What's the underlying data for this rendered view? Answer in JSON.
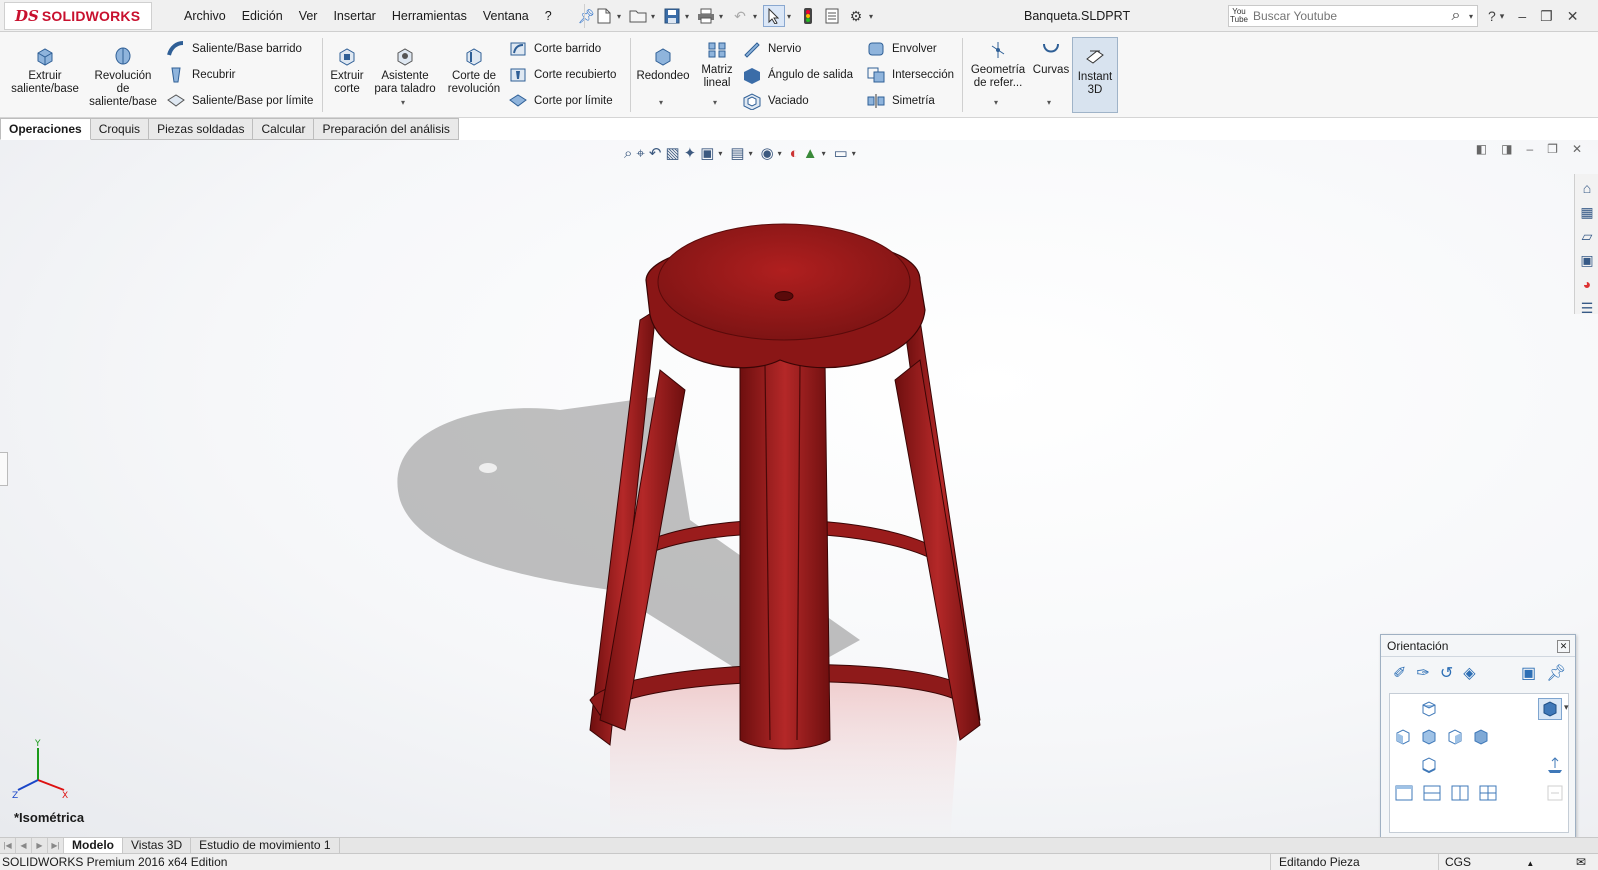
{
  "app": {
    "logo_prefix": "DS",
    "logo_text": "SOLIDWORKS"
  },
  "menu": [
    "Archivo",
    "Edición",
    "Ver",
    "Insertar",
    "Herramientas",
    "Ventana",
    "?"
  ],
  "document_title": "Banqueta.SLDPRT",
  "search": {
    "placeholder": "Buscar Youtube",
    "provider_badge": "You Tube"
  },
  "ribbon": {
    "extruir_saliente": "Extruir saliente/base",
    "revolucion_saliente": "Revolución de saliente/base",
    "saliente_barrido": "Saliente/Base barrido",
    "recubrir": "Recubrir",
    "saliente_limite": "Saliente/Base por límite",
    "extruir_corte": "Extruir corte",
    "asistente_taladro": "Asistente para taladro",
    "corte_revolucion": "Corte de revolución",
    "corte_barrido": "Corte barrido",
    "corte_recubierto": "Corte recubierto",
    "corte_limite": "Corte por límite",
    "redondeo": "Redondeo",
    "matriz_lineal": "Matriz lineal",
    "nervio": "Nervio",
    "angulo_salida": "Ángulo de salida",
    "vaciado": "Vaciado",
    "envolver": "Envolver",
    "interseccion": "Intersección",
    "simetria": "Simetría",
    "geometria_referencia": "Geometría de refer...",
    "curvas": "Curvas",
    "instant3d": "Instant 3D"
  },
  "tabs": [
    "Operaciones",
    "Croquis",
    "Piezas soldadas",
    "Calcular",
    "Preparación del análisis"
  ],
  "viewport": {
    "view_name": "*Isométrica",
    "model_color": "#8e1a1a"
  },
  "orientation": {
    "title": "Orientación"
  },
  "bottom_tabs": [
    "Modelo",
    "Vistas 3D",
    "Estudio de movimiento 1"
  ],
  "status": {
    "edition": "SOLIDWORKS Premium 2016 x64 Edition",
    "mode": "Editando Pieza",
    "units": "CGS"
  }
}
